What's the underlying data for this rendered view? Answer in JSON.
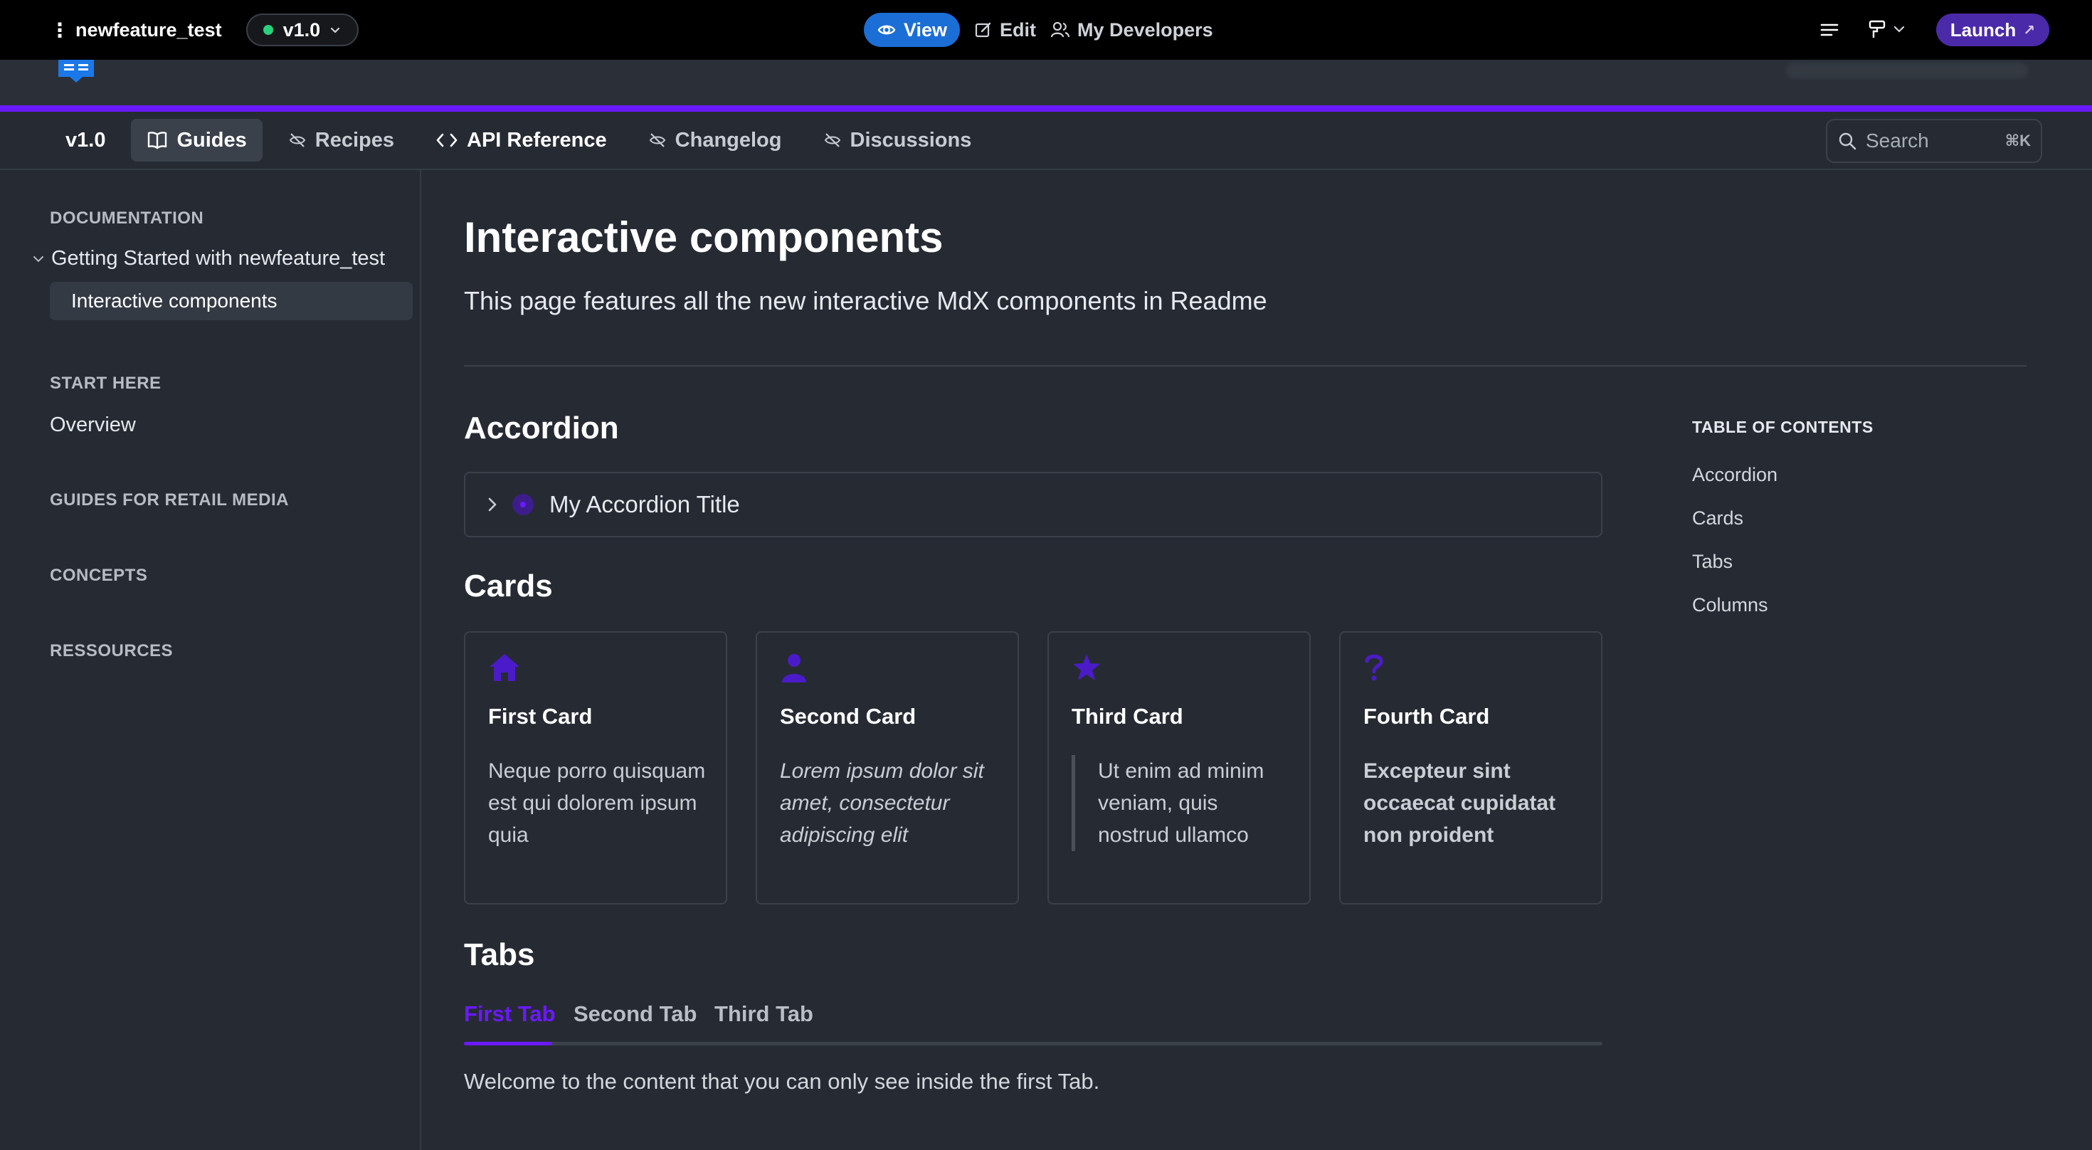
{
  "adminbar": {
    "project_name": "newfeature_test",
    "version": "v1.0",
    "view_label": "View",
    "edit_label": "Edit",
    "developers_label": "My Developers",
    "launch_label": "Launch"
  },
  "nav": {
    "version": "v1.0",
    "items": [
      {
        "label": "Guides",
        "icon": "book-icon",
        "active": true
      },
      {
        "label": "Recipes",
        "icon": "eye-off-icon"
      },
      {
        "label": "API Reference",
        "icon": "code-icon"
      },
      {
        "label": "Changelog",
        "icon": "eye-off-icon"
      },
      {
        "label": "Discussions",
        "icon": "eye-off-icon"
      }
    ],
    "search_label": "Search",
    "search_shortcut": "⌘K"
  },
  "sidebar": {
    "sections": [
      {
        "title": "DOCUMENTATION"
      },
      {
        "title": "START HERE"
      },
      {
        "title": "GUIDES FOR RETAIL MEDIA"
      },
      {
        "title": "CONCEPTS"
      },
      {
        "title": "RESSOURCES"
      }
    ],
    "parent_page": "Getting Started with newfeature_test",
    "active_page": "Interactive components",
    "overview": "Overview"
  },
  "page": {
    "title": "Interactive components",
    "subtitle": "This page features all the new interactive MdX components in Readme",
    "accordion_heading": "Accordion",
    "accordion_title": "My Accordion Title",
    "cards_heading": "Cards",
    "cards": [
      {
        "title": "First Card",
        "body": "Neque porro quisquam est qui dolorem ipsum quia",
        "icon": "house-icon"
      },
      {
        "title": "Second Card",
        "body": "Lorem ipsum dolor sit amet, consectetur adipiscing elit",
        "icon": "user-icon"
      },
      {
        "title": "Third Card",
        "body": "Ut enim ad minim veniam, quis nostrud ullamco",
        "icon": "star-icon"
      },
      {
        "title": "Fourth Card",
        "body": "Excepteur sint occaecat cupidatat non proident",
        "icon": "question-icon"
      }
    ],
    "tabs_heading": "Tabs",
    "tabs": [
      "First Tab",
      "Second Tab",
      "Third Tab"
    ],
    "tab_content": "Welcome to the content that you can only see inside the first Tab."
  },
  "toc": {
    "heading": "TABLE OF CONTENTS",
    "links": [
      "Accordion",
      "Cards",
      "Tabs",
      "Columns"
    ]
  },
  "colors": {
    "accent": "#6b19ff",
    "view_button": "#1b6ed6",
    "launch_button": "#4a2aa8",
    "background": "#262b33"
  }
}
